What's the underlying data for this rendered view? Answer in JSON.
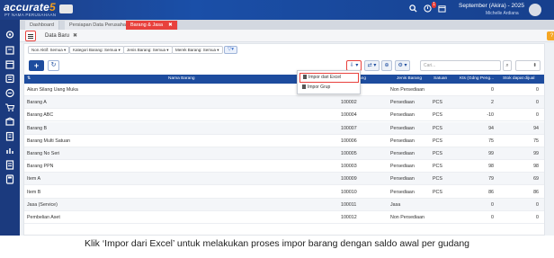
{
  "app": {
    "brand": "accurate",
    "brand_suffix": "5",
    "sub_brand": "PT NAMA PERUSAHAAN",
    "period": "September (Akira) - 2025",
    "user": "Michelle Ardiana"
  },
  "topbar": {
    "notifications_badge": "1"
  },
  "tabs": [
    {
      "label": "Dashboard"
    },
    {
      "label": "Persiapan Data Perusahaan"
    },
    {
      "label": "Barang & Jasa",
      "close": "✖"
    }
  ],
  "subheader": {
    "new_data_label": "Data Baru",
    "close": "✖"
  },
  "filters": [
    {
      "label": "Non Aktif: Semua ▾"
    },
    {
      "label": "Kategori Barang: Semua ▾"
    },
    {
      "label": "Jenis Barang: Semua ▾"
    },
    {
      "label": "Merek Barang: Semua ▾"
    }
  ],
  "toolbar": {
    "add_label": "+",
    "refresh_label": "↻",
    "import_label": "⇩ ▾",
    "export_label": "⇄ ▾",
    "print_label": "⊕",
    "settings_label": "⚙ ▾",
    "search_placeholder": "Cari...",
    "search_icon": "⌕"
  },
  "dropdown": {
    "items": [
      {
        "label": "Impor dari Excel"
      },
      {
        "label": "Impor Grup"
      }
    ]
  },
  "table": {
    "headers": [
      "Nama Barang",
      "Kode Barang",
      "Jenis Barang",
      "Satuan",
      "Kts (Gdng Peng...",
      "Stok dapat dijual"
    ],
    "rows": [
      {
        "name": "Akun Silang Uang Muka",
        "code": "",
        "type": "Non Persediaan",
        "unit": "",
        "qty": "0",
        "stock": "0"
      },
      {
        "name": "Barang A",
        "code": "100002",
        "type": "Persediaan",
        "unit": "PCS",
        "qty": "2",
        "stock": "0"
      },
      {
        "name": "Barang ABC",
        "code": "100004",
        "type": "Persediaan",
        "unit": "PCS",
        "qty": "-10",
        "stock": "0"
      },
      {
        "name": "Barang B",
        "code": "100007",
        "type": "Persediaan",
        "unit": "PCS",
        "qty": "94",
        "stock": "94"
      },
      {
        "name": "Barang Multi Satuan",
        "code": "100006",
        "type": "Persediaan",
        "unit": "PCS",
        "qty": "75",
        "stock": "75"
      },
      {
        "name": "Barang No Seri",
        "code": "100005",
        "type": "Persediaan",
        "unit": "PCS",
        "qty": "99",
        "stock": "99"
      },
      {
        "name": "Barang PPN",
        "code": "100003",
        "type": "Persediaan",
        "unit": "PCS",
        "qty": "98",
        "stock": "98"
      },
      {
        "name": "Item A",
        "code": "100009",
        "type": "Persediaan",
        "unit": "PCS",
        "qty": "79",
        "stock": "69"
      },
      {
        "name": "Item B",
        "code": "100010",
        "type": "Persediaan",
        "unit": "PCS",
        "qty": "86",
        "stock": "86"
      },
      {
        "name": "Jasa (Service)",
        "code": "100011",
        "type": "Jasa",
        "unit": "",
        "qty": "0",
        "stock": "0"
      },
      {
        "name": "Pembelian Aset",
        "code": "100012",
        "type": "Non Persediaan",
        "unit": "",
        "qty": "0",
        "stock": "0"
      }
    ]
  },
  "caption": "Klik ‘Impor dari Excel’ untuk melakukan proses impor barang dengan saldo awal per gudang",
  "colors": {
    "nav": "#1b3a7e",
    "header_row": "#1d4c9e",
    "highlight": "#e8413c",
    "active_tab": "#e8413c",
    "orange": "#f5a623"
  },
  "icons": {
    "nav": [
      "settings-icon",
      "company-icon",
      "calendar-icon",
      "list-icon",
      "sales-icon",
      "cart-icon",
      "inventory-icon",
      "building-icon",
      "report-icon",
      "document-icon",
      "calculator-icon"
    ]
  }
}
